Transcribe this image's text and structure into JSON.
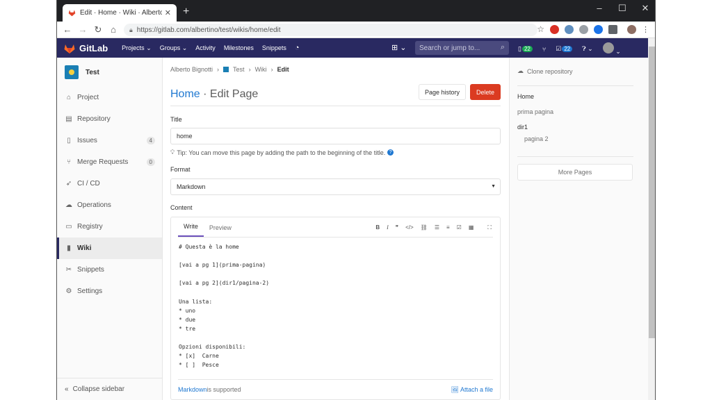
{
  "browser": {
    "tab_title": "Edit · Home · Wiki · Alberto Bigno",
    "url": "https://gitlab.com/albertino/test/wikis/home/edit"
  },
  "gitlab": {
    "brand": "GitLab",
    "nav": [
      "Projects",
      "Groups",
      "Activity",
      "Milestones",
      "Snippets"
    ],
    "search_placeholder": "Search or jump to...",
    "issues_badge": "22",
    "todos_badge": "22"
  },
  "sidebar": {
    "project_name": "Test",
    "items": [
      {
        "label": "Project",
        "icon": "home-icon"
      },
      {
        "label": "Repository",
        "icon": "doc-icon"
      },
      {
        "label": "Issues",
        "icon": "issues-icon",
        "count": "4"
      },
      {
        "label": "Merge Requests",
        "icon": "merge-icon",
        "count": "0"
      },
      {
        "label": "CI / CD",
        "icon": "rocket-icon"
      },
      {
        "label": "Operations",
        "icon": "cloud-gear-icon"
      },
      {
        "label": "Registry",
        "icon": "container-icon"
      },
      {
        "label": "Wiki",
        "icon": "book-icon"
      },
      {
        "label": "Snippets",
        "icon": "scissors-icon"
      },
      {
        "label": "Settings",
        "icon": "gear-icon"
      }
    ],
    "collapse": "Collapse sidebar"
  },
  "breadcrumb": [
    "Alberto Bignotti",
    "Test",
    "Wiki",
    "Edit"
  ],
  "page": {
    "title_home": "Home",
    "title_rest": " · Edit Page",
    "history_button": "Page history",
    "delete_button": "Delete",
    "title_label": "Title",
    "title_value": "home",
    "tip": "Tip: You can move this page by adding the path to the beginning of the title.",
    "format_label": "Format",
    "format_value": "Markdown",
    "content_label": "Content",
    "write_tab": "Write",
    "preview_tab": "Preview",
    "content": "# Questa è la home\n\n[vai a pg 1](prima-pagina)\n\n[vai a pg 2](dir1/pagina-2)\n\nUna lista:\n* uno\n* due\n* tre\n\nOpzioni disponibili:\n* [x]  Carne\n* [ ]  Pesce",
    "footer_link": "Markdown",
    "footer_text": " is supported",
    "attach": "Attach a file"
  },
  "wiki_sidebar": {
    "clone": "Clone repository",
    "pages": [
      "Home",
      "prima pagina",
      "dir1",
      "pagina 2"
    ],
    "more": "More Pages"
  },
  "colors": {
    "nav_bg": "#292961",
    "link": "#1f78d1",
    "delete": "#db3b21"
  }
}
